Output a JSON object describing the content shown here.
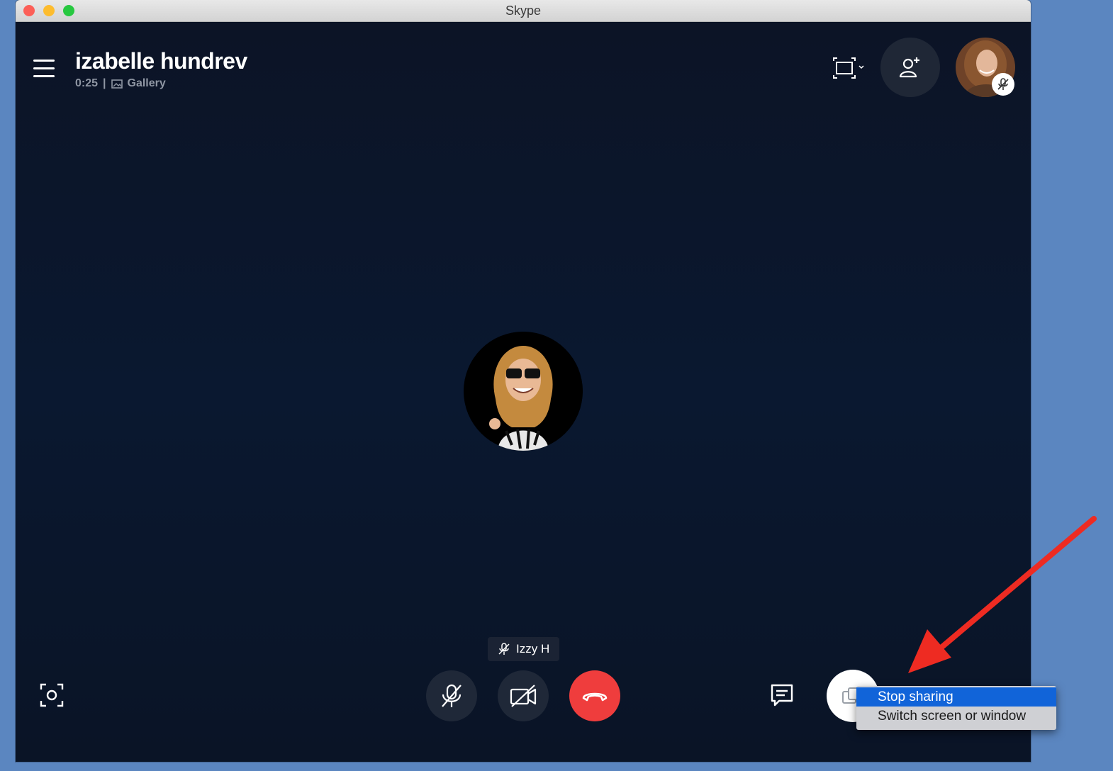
{
  "window": {
    "title": "Skype"
  },
  "call": {
    "contact_name": "izabelle hundrev",
    "duration": "0:25",
    "separator": "|",
    "view_mode": "Gallery"
  },
  "participant": {
    "display_name": "Izzy H",
    "muted": true
  },
  "context_menu": {
    "items": [
      "Stop sharing",
      "Switch screen or window"
    ],
    "highlighted_index": 0
  },
  "icons": [
    "menu-icon",
    "gallery-icon",
    "fit-screen-icon",
    "add-person-icon",
    "mic-muted-icon",
    "camera-off-icon",
    "hang-up-icon",
    "snapshot-icon",
    "chat-icon",
    "share-screen-icon"
  ],
  "colors": {
    "stage_bg": "#0b1426",
    "hang_up": "#ef3d3d",
    "menu_highlight": "#1164d9",
    "annotation_arrow": "#ee2b22",
    "desktop_bg": "#5b86c0"
  }
}
